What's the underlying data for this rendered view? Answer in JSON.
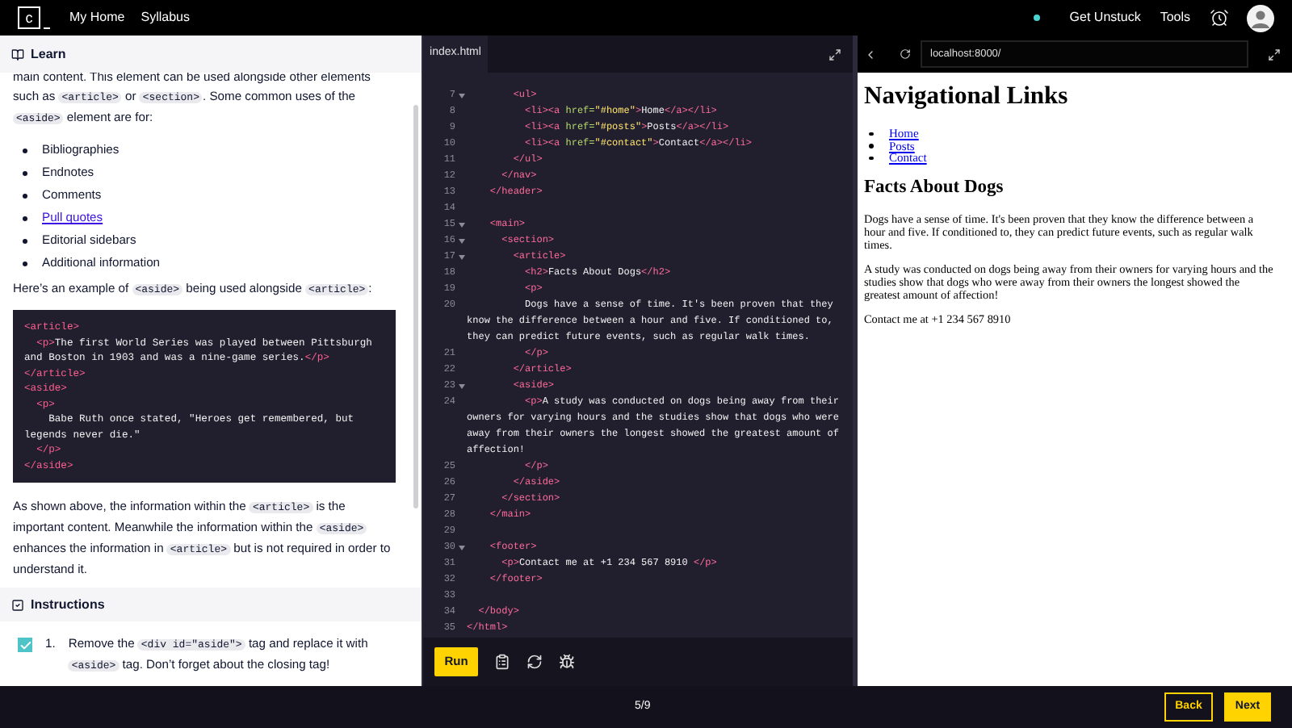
{
  "top_bar": {
    "logo_text": "c",
    "nav": [
      {
        "label": "My Home"
      },
      {
        "label": "Syllabus"
      }
    ],
    "actions": [
      {
        "label": "Get Unstuck"
      },
      {
        "label": "Tools"
      }
    ]
  },
  "learn": {
    "title": "Learn",
    "blocks": [
      {
        "kind": "paragraph",
        "segments": [
          {
            "kind": "text",
            "text": "main content. This element can be used alongside other elements such as "
          },
          {
            "kind": "code",
            "text": "<article>"
          },
          {
            "kind": "text",
            "text": " or "
          },
          {
            "kind": "code",
            "text": "<section>"
          },
          {
            "kind": "text",
            "text": ". Some common uses of the "
          },
          {
            "kind": "code",
            "text": "<aside>"
          },
          {
            "kind": "text",
            "text": " element are for:"
          }
        ]
      },
      {
        "kind": "list",
        "items": [
          {
            "text": "Bibliographies",
            "link": false
          },
          {
            "text": "Endnotes",
            "link": false
          },
          {
            "text": "Comments",
            "link": false
          },
          {
            "text": "Pull quotes",
            "link": true
          },
          {
            "text": "Editorial sidebars",
            "link": false
          },
          {
            "text": "Additional information",
            "link": false
          }
        ]
      },
      {
        "kind": "paragraph",
        "segments": [
          {
            "kind": "text",
            "text": "Here’s an example of "
          },
          {
            "kind": "code",
            "text": "<aside>"
          },
          {
            "kind": "text",
            "text": " being used alongside "
          },
          {
            "kind": "code",
            "text": "<article>"
          },
          {
            "kind": "text",
            "text": ":"
          }
        ]
      },
      {
        "kind": "code_block",
        "lines": [
          [
            {
              "kind": "tag",
              "text": "<article>"
            }
          ],
          [
            {
              "kind": "tag",
              "text": "  <p>"
            },
            {
              "kind": "text",
              "text": "The first World Series was played between Pittsburgh and Boston in 1903 and was a nine-game series."
            },
            {
              "kind": "tag",
              "text": "</p>"
            }
          ],
          [
            {
              "kind": "tag",
              "text": "</article>"
            }
          ],
          [
            {
              "kind": "tag",
              "text": "<aside>"
            }
          ],
          [
            {
              "kind": "tag",
              "text": "  <p>"
            }
          ],
          [
            {
              "kind": "text",
              "text": "    Babe Ruth once stated, \"Heroes get remembered, but legends never die.\""
            }
          ],
          [
            {
              "kind": "tag",
              "text": "  </p>"
            }
          ],
          [
            {
              "kind": "tag",
              "text": "</aside>"
            }
          ]
        ]
      },
      {
        "kind": "paragraph",
        "segments": [
          {
            "kind": "text",
            "text": "As shown above, the information within the "
          },
          {
            "kind": "code",
            "text": "<article>"
          },
          {
            "kind": "text",
            "text": " is the important content. Meanwhile the information within the "
          },
          {
            "kind": "code",
            "text": "<aside>"
          },
          {
            "kind": "text",
            "text": " enhances the information in "
          },
          {
            "kind": "code",
            "text": "<article>"
          },
          {
            "kind": "text",
            "text": " but is not required in order to understand it."
          }
        ]
      }
    ]
  },
  "instructions": {
    "title": "Instructions",
    "tasks": [
      {
        "checked": true,
        "number": "1.",
        "segments": [
          {
            "kind": "text",
            "text": "Remove the "
          },
          {
            "kind": "code",
            "text": "<div id=\"aside\">"
          },
          {
            "kind": "text",
            "text": " tag and replace it with "
          },
          {
            "kind": "code",
            "text": "<aside>"
          },
          {
            "kind": "text",
            "text": " tag. Don’t forget about the closing tag!"
          }
        ]
      }
    ]
  },
  "editor": {
    "tab": "index.html",
    "lines": [
      {
        "n": "7",
        "fold": true,
        "tokens": [
          {
            "kind": "tag",
            "text": "        <ul>"
          }
        ]
      },
      {
        "n": "8",
        "fold": false,
        "tokens": [
          {
            "kind": "tag",
            "text": "          <li><a"
          },
          {
            "kind": "attr",
            "text": " href="
          },
          {
            "kind": "str",
            "text": "\"#home\""
          },
          {
            "kind": "tag",
            "text": ">"
          },
          {
            "kind": "text",
            "text": "Home"
          },
          {
            "kind": "tag",
            "text": "</a></li>"
          }
        ]
      },
      {
        "n": "9",
        "fold": false,
        "tokens": [
          {
            "kind": "tag",
            "text": "          <li><a"
          },
          {
            "kind": "attr",
            "text": " href="
          },
          {
            "kind": "str",
            "text": "\"#posts\""
          },
          {
            "kind": "tag",
            "text": ">"
          },
          {
            "kind": "text",
            "text": "Posts"
          },
          {
            "kind": "tag",
            "text": "</a></li>"
          }
        ]
      },
      {
        "n": "10",
        "fold": false,
        "tokens": [
          {
            "kind": "tag",
            "text": "          <li><a"
          },
          {
            "kind": "attr",
            "text": " href="
          },
          {
            "kind": "str",
            "text": "\"#contact\""
          },
          {
            "kind": "tag",
            "text": ">"
          },
          {
            "kind": "text",
            "text": "Contact"
          },
          {
            "kind": "tag",
            "text": "</a></li>"
          }
        ]
      },
      {
        "n": "11",
        "fold": false,
        "tokens": [
          {
            "kind": "tag",
            "text": "        </ul>"
          }
        ]
      },
      {
        "n": "12",
        "fold": false,
        "tokens": [
          {
            "kind": "tag",
            "text": "      </nav>"
          }
        ]
      },
      {
        "n": "13",
        "fold": false,
        "tokens": [
          {
            "kind": "tag",
            "text": "    </header>"
          }
        ]
      },
      {
        "n": "14",
        "fold": false
      },
      {
        "n": "15",
        "fold": true,
        "tokens": [
          {
            "kind": "tag",
            "text": "    <main>"
          }
        ]
      },
      {
        "n": "16",
        "fold": true,
        "tokens": [
          {
            "kind": "tag",
            "text": "      <section>"
          }
        ]
      },
      {
        "n": "17",
        "fold": true,
        "tokens": [
          {
            "kind": "tag",
            "text": "        <article>"
          }
        ]
      },
      {
        "n": "18",
        "fold": false,
        "tokens": [
          {
            "kind": "tag",
            "text": "          <h2>"
          },
          {
            "kind": "text",
            "text": "Facts About Dogs"
          },
          {
            "kind": "tag",
            "text": "</h2>"
          }
        ]
      },
      {
        "n": "19",
        "fold": false,
        "tokens": [
          {
            "kind": "tag",
            "text": "          <p>"
          }
        ]
      },
      {
        "n": "20",
        "fold": false,
        "tokens": [
          {
            "kind": "text",
            "text": "          Dogs have a sense of time. It's been proven that they know the difference between a hour and five. If conditioned to, they can predict future events, such as regular walk times."
          }
        ]
      },
      {
        "n": "21",
        "fold": false,
        "tokens": [
          {
            "kind": "tag",
            "text": "          </p>"
          }
        ]
      },
      {
        "n": "22",
        "fold": false,
        "tokens": [
          {
            "kind": "tag",
            "text": "        </article>"
          }
        ]
      },
      {
        "n": "23",
        "fold": true,
        "tokens": [
          {
            "kind": "tag",
            "text": "        <aside>"
          }
        ]
      },
      {
        "n": "24",
        "fold": false,
        "tokens": [
          {
            "kind": "tag",
            "text": "          <p>"
          },
          {
            "kind": "text",
            "text": "A study was conducted on dogs being away from their owners for varying hours and the studies show that dogs who were away from their owners the longest showed the greatest amount of affection!"
          }
        ]
      },
      {
        "n": "25",
        "fold": false,
        "tokens": [
          {
            "kind": "tag",
            "text": "          </p>"
          }
        ]
      },
      {
        "n": "26",
        "fold": false,
        "tokens": [
          {
            "kind": "tag",
            "text": "        </aside>"
          }
        ]
      },
      {
        "n": "27",
        "fold": false,
        "tokens": [
          {
            "kind": "tag",
            "text": "      </section>"
          }
        ]
      },
      {
        "n": "28",
        "fold": false,
        "tokens": [
          {
            "kind": "tag",
            "text": "    </main>"
          }
        ]
      },
      {
        "n": "29",
        "fold": false
      },
      {
        "n": "30",
        "fold": true,
        "tokens": [
          {
            "kind": "tag",
            "text": "    <footer>"
          }
        ]
      },
      {
        "n": "31",
        "fold": false,
        "tokens": [
          {
            "kind": "tag",
            "text": "      <p>"
          },
          {
            "kind": "text",
            "text": "Contact me at +1 234 567 8910 "
          },
          {
            "kind": "tag",
            "text": "</p>"
          }
        ]
      },
      {
        "n": "32",
        "fold": false,
        "tokens": [
          {
            "kind": "tag",
            "text": "    </footer>"
          }
        ]
      },
      {
        "n": "33",
        "fold": false
      },
      {
        "n": "34",
        "fold": false,
        "tokens": [
          {
            "kind": "tag",
            "text": "  </body>"
          }
        ]
      },
      {
        "n": "35",
        "fold": false,
        "tokens": [
          {
            "kind": "tag",
            "text": "</html>"
          }
        ]
      }
    ],
    "run_label": "Run"
  },
  "browser": {
    "url": "localhost:8000/",
    "heading": "Navigational Links",
    "links": [
      "Home",
      "Posts",
      "Contact"
    ],
    "subheading": "Facts About Dogs",
    "paragraphs": [
      "Dogs have a sense of time. It's been proven that they know the difference between a hour and five. If conditioned to, they can predict future events, such as regular walk times.",
      "A study was conducted on dogs being away from their owners for varying hours and the studies show that dogs who were away from their owners the longest showed the greatest amount of affection!",
      "Contact me at +1 234 567 8910"
    ]
  },
  "footer": {
    "progress": "5/9",
    "back": "Back",
    "next": "Next"
  }
}
